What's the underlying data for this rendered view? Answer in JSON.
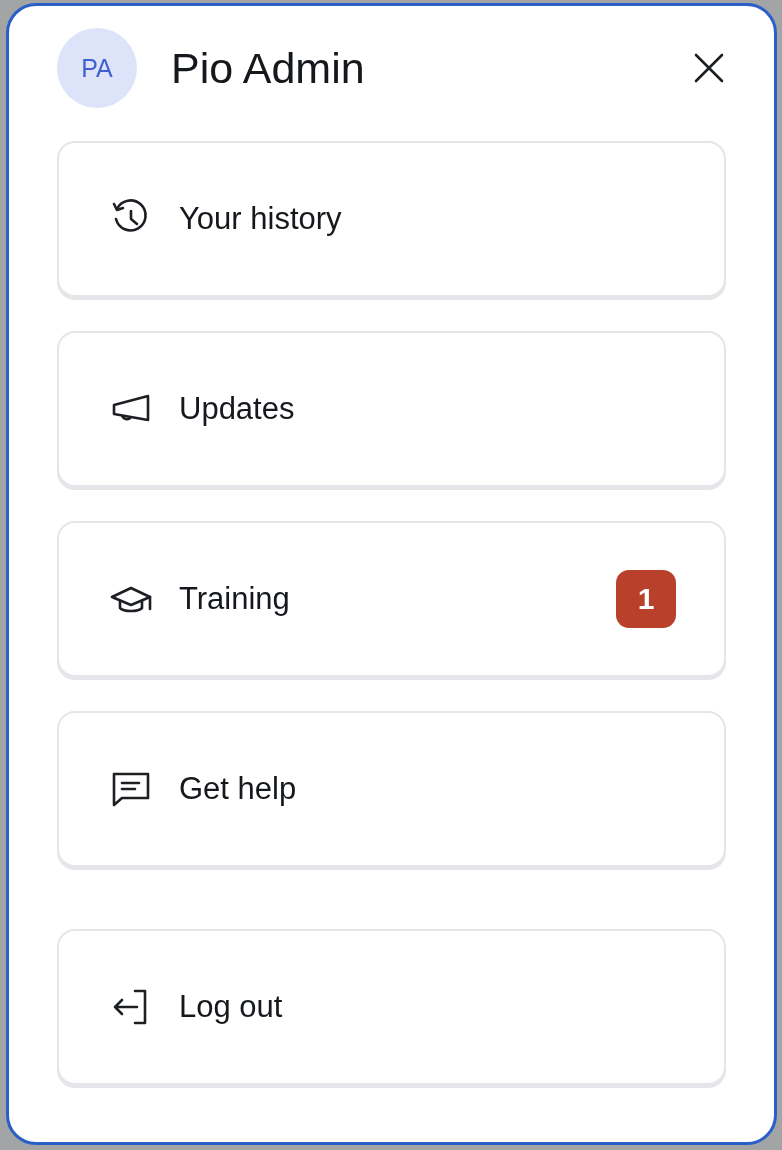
{
  "profile": {
    "initials": "PA",
    "name": "Pio Admin"
  },
  "items": [
    {
      "kind": "history",
      "label": "Your history"
    },
    {
      "kind": "updates",
      "label": "Updates"
    },
    {
      "kind": "training",
      "label": "Training",
      "badge": "1"
    },
    {
      "kind": "help",
      "label": "Get help"
    },
    {
      "kind": "logout",
      "label": "Log out"
    }
  ]
}
